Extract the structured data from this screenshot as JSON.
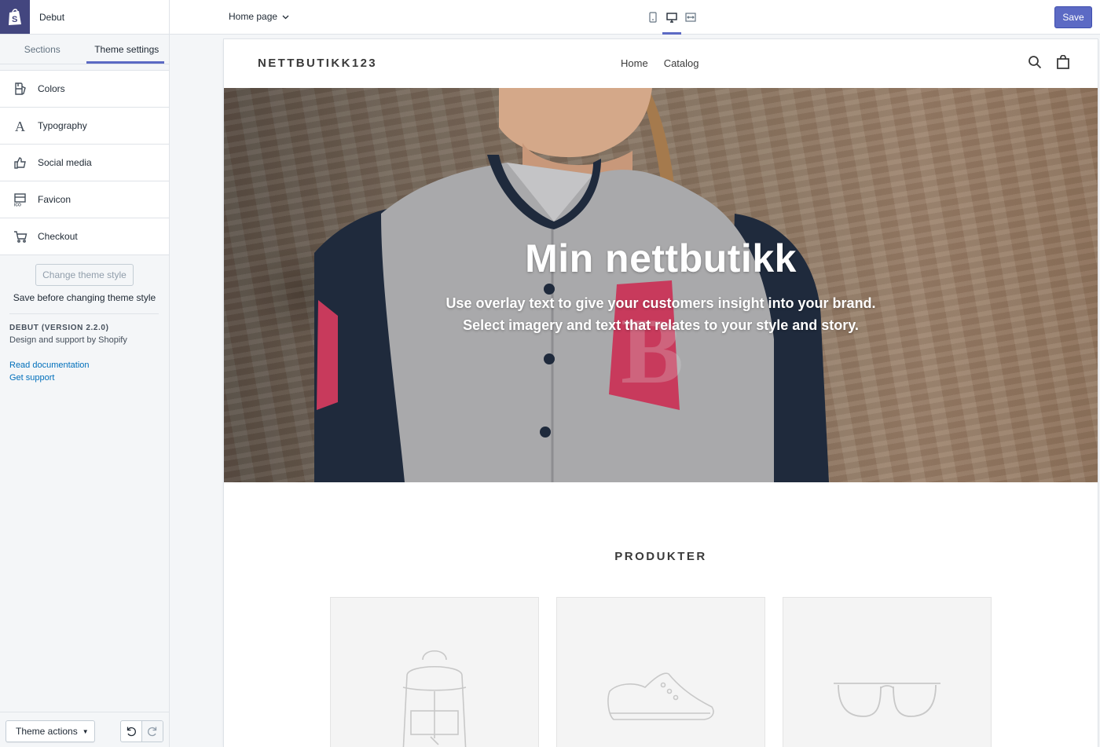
{
  "app": {
    "theme_name": "Debut",
    "logo": "shopify-bag-icon",
    "accent_color": "#5c6ac4"
  },
  "tabs": [
    {
      "label": "Sections",
      "active": false
    },
    {
      "label": "Theme settings",
      "active": true
    }
  ],
  "settings": [
    {
      "label": "Colors",
      "icon": "paint-bucket-icon"
    },
    {
      "label": "Typography",
      "icon": "typography-icon"
    },
    {
      "label": "Social media",
      "icon": "thumbs-up-icon"
    },
    {
      "label": "Favicon",
      "icon": "favicon-icon"
    },
    {
      "label": "Checkout",
      "icon": "cart-icon"
    }
  ],
  "theme_style": {
    "button_label": "Change theme style",
    "note": "Save before changing theme style"
  },
  "theme_info": {
    "version": "DEBUT (VERSION 2.2.0)",
    "support": "Design and support by Shopify",
    "doc_link": "Read documentation",
    "support_link": "Get support"
  },
  "footer": {
    "theme_actions_label": "Theme actions"
  },
  "topbar": {
    "page_select": "Home page",
    "devices": [
      "mobile-icon",
      "desktop-icon",
      "fullscreen-icon"
    ],
    "active_device": "desktop-icon",
    "save_label": "Save"
  },
  "store": {
    "logo": "NETTBUTIKK123",
    "nav": [
      "Home",
      "Catalog"
    ],
    "hero_title": "Min nettbutikk",
    "hero_sub_1": "Use overlay text to give your customers insight into your brand.",
    "hero_sub_2": "Select imagery and text that relates to your style and story.",
    "products_title": "PRODUKTER",
    "products": [
      {
        "icon": "backpack-icon"
      },
      {
        "icon": "shoe-icon"
      },
      {
        "icon": "glasses-icon"
      }
    ]
  }
}
